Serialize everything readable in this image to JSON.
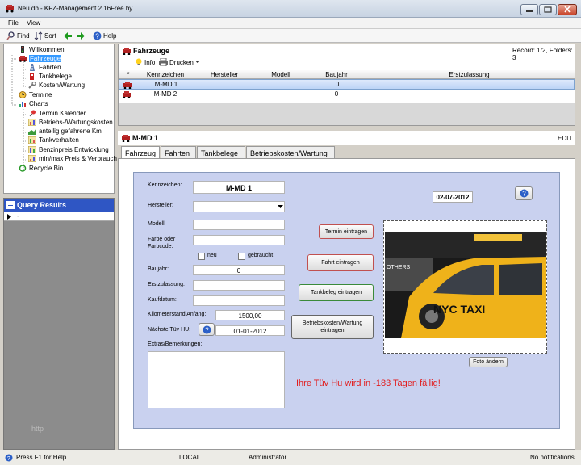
{
  "window": {
    "title": "Neu.db - KFZ-Management 2.16Free by"
  },
  "menu": {
    "file": "File",
    "view": "View"
  },
  "toolbar": {
    "find": "Find",
    "sort": "Sort",
    "help": "Help"
  },
  "tree": {
    "willkommen": "Willkommen",
    "fahrzeuge": "Fahrzeuge",
    "fahrten": "Fahrten",
    "tankbelege": "Tankbelege",
    "kosten": "Kosten/Wartung",
    "termine": "Termine",
    "charts": "Charts",
    "c1": "Termin Kalender",
    "c2": "Betriebs-/Wartungskosten",
    "c3": "anteilig gefahrene Km",
    "c4": "Tankverhalten",
    "c5": "Benzinpreis Entwicklung",
    "c6": "min/max Preis & Verbrauch",
    "recycle": "Recycle Bin"
  },
  "query": {
    "title": "Query Results",
    "row_value": "-",
    "watermark": "http"
  },
  "grid": {
    "title": "Fahrzeuge",
    "record_info": "Record: 1/2, Folders: 3",
    "info": "Info",
    "drucken": "Drucken",
    "columns": {
      "star": "*",
      "kennzeichen": "Kennzeichen",
      "hersteller": "Hersteller",
      "modell": "Modell",
      "baujahr": "Baujahr",
      "erstzulassung": "Erstzulassung"
    },
    "rows": [
      {
        "kennzeichen": "M-MD 1",
        "baujahr": "0"
      },
      {
        "kennzeichen": "M-MD 2",
        "baujahr": "0"
      }
    ]
  },
  "detail": {
    "title": "M-MD 1",
    "edit": "EDIT",
    "tabs": [
      "Fahrzeug",
      "Fahrten",
      "Tankbelege",
      "Betriebskosten/Wartung"
    ]
  },
  "form": {
    "kennzeichen_label": "Kennzeichen:",
    "kennzeichen_value": "M-MD 1",
    "hersteller_label": "Hersteller:",
    "modell_label": "Modell:",
    "farbe_label": "Farbe oder Farbcode:",
    "neu_label": "neu",
    "gebraucht_label": "gebraucht",
    "baujahr_label": "Baujahr:",
    "baujahr_value": "0",
    "erstzulassung_label": "Erstzulassung:",
    "kaufdatum_label": "Kaufdatum:",
    "km_label": "Kilometerstand Anfang:",
    "km_value": "1500,00",
    "tuev_label": "Nächste Tüv HU:",
    "tuev_value": "01-01-2012",
    "extras_label": "Extras/Bemerkungen:",
    "date": "02-07-2012",
    "btn_termin": "Termin eintragen",
    "btn_fahrt": "Fahrt eintragen",
    "btn_tank": "Tankbeleg eintragen",
    "btn_betrieb": "Betriebskosten/Wartung eintragen",
    "btn_foto": "Foto ändern",
    "warning": "Ihre Tüv Hu wird in -183 Tagen fällig!",
    "photo_text_1": "OTHERS",
    "photo_text_2": "NYC TAXI",
    "warning_color": "#e21c1c"
  },
  "status": {
    "help": "Press F1 for Help",
    "local": "LOCAL",
    "user": "Administrator",
    "notifications": "No notifications"
  }
}
